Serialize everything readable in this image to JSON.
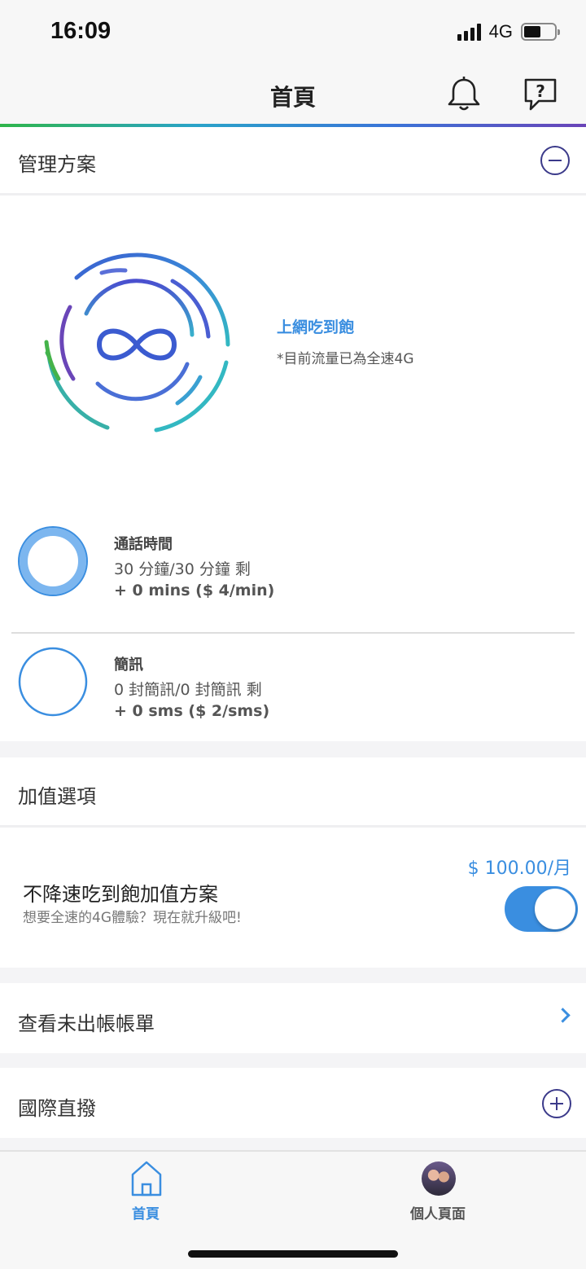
{
  "status_bar": {
    "time": "16:09",
    "network": "4G"
  },
  "header": {
    "title": "首頁"
  },
  "manage_plan": {
    "title": "管理方案",
    "unlimited_title": "上網吃到飽",
    "unlimited_note": "*目前流量已為全速4G",
    "call": {
      "title": "通話時間",
      "remaining": "30 分鐘/30 分鐘 剩",
      "extra": "+ 0 mins ($ 4/min)",
      "fraction_remaining": 1.0
    },
    "sms": {
      "title": "簡訊",
      "remaining": "0 封簡訊/0 封簡訊 剩",
      "extra": "+ 0 sms ($ 2/sms)",
      "fraction_remaining": 0
    }
  },
  "addons": {
    "title": "加值選項",
    "item": {
      "price": "$ 100.00/月",
      "name": "不降速吃到飽加值方案",
      "desc": "想要全速的4G體驗？現在就升級吧!",
      "enabled": true
    }
  },
  "unbilled": {
    "title": "查看未出帳帳單"
  },
  "idd": {
    "title": "國際直撥"
  },
  "tabbar": {
    "home_label": "首頁",
    "profile_label": "個人頁面"
  },
  "colors": {
    "accent": "#3a8ee0",
    "dark_purple": "#3b3a8a"
  }
}
